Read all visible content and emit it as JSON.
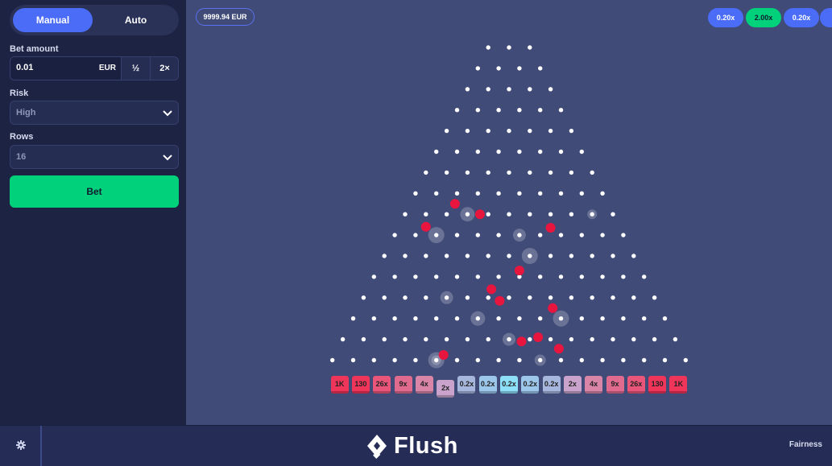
{
  "sidebar": {
    "mode_manual": "Manual",
    "mode_auto": "Auto",
    "bet_amount_label": "Bet amount",
    "bet_value": "0.01",
    "bet_currency": "EUR",
    "half_label": "½",
    "double_label": "2×",
    "risk_label": "Risk",
    "risk_value": "High",
    "rows_label": "Rows",
    "rows_value": "16",
    "bet_button": "Bet"
  },
  "balance": "9999.94 EUR",
  "history": [
    {
      "label": "0.20x",
      "color": "#4a6cf7"
    },
    {
      "label": "2.00x",
      "color": "#00d17a"
    },
    {
      "label": "0.20x",
      "color": "#4a6cf7"
    }
  ],
  "board": {
    "rows": 16,
    "multipliers": [
      "1K",
      "130",
      "26x",
      "9x",
      "4x",
      "2x",
      "0.2x",
      "0.2x",
      "0.2x",
      "0.2x",
      "0.2x",
      "2x",
      "4x",
      "9x",
      "26x",
      "130",
      "1K"
    ],
    "slot_colors": [
      "#f0355a",
      "#f0355a",
      "#e9567a",
      "#e06b8f",
      "#d985a8",
      "#c9a3cb",
      "#a6b6dd",
      "#9cc6ea",
      "#8de0f8",
      "#9cc6ea",
      "#a6b6dd",
      "#c9a3cb",
      "#d985a8",
      "#e06b8f",
      "#e9567a",
      "#f0355a",
      "#f0355a"
    ],
    "active_slot_index": 5,
    "ball_color": "#e8163f",
    "peg_color": "#ffffff"
  },
  "footer": {
    "logo_text": "Flush",
    "fairness": "Fairness"
  }
}
